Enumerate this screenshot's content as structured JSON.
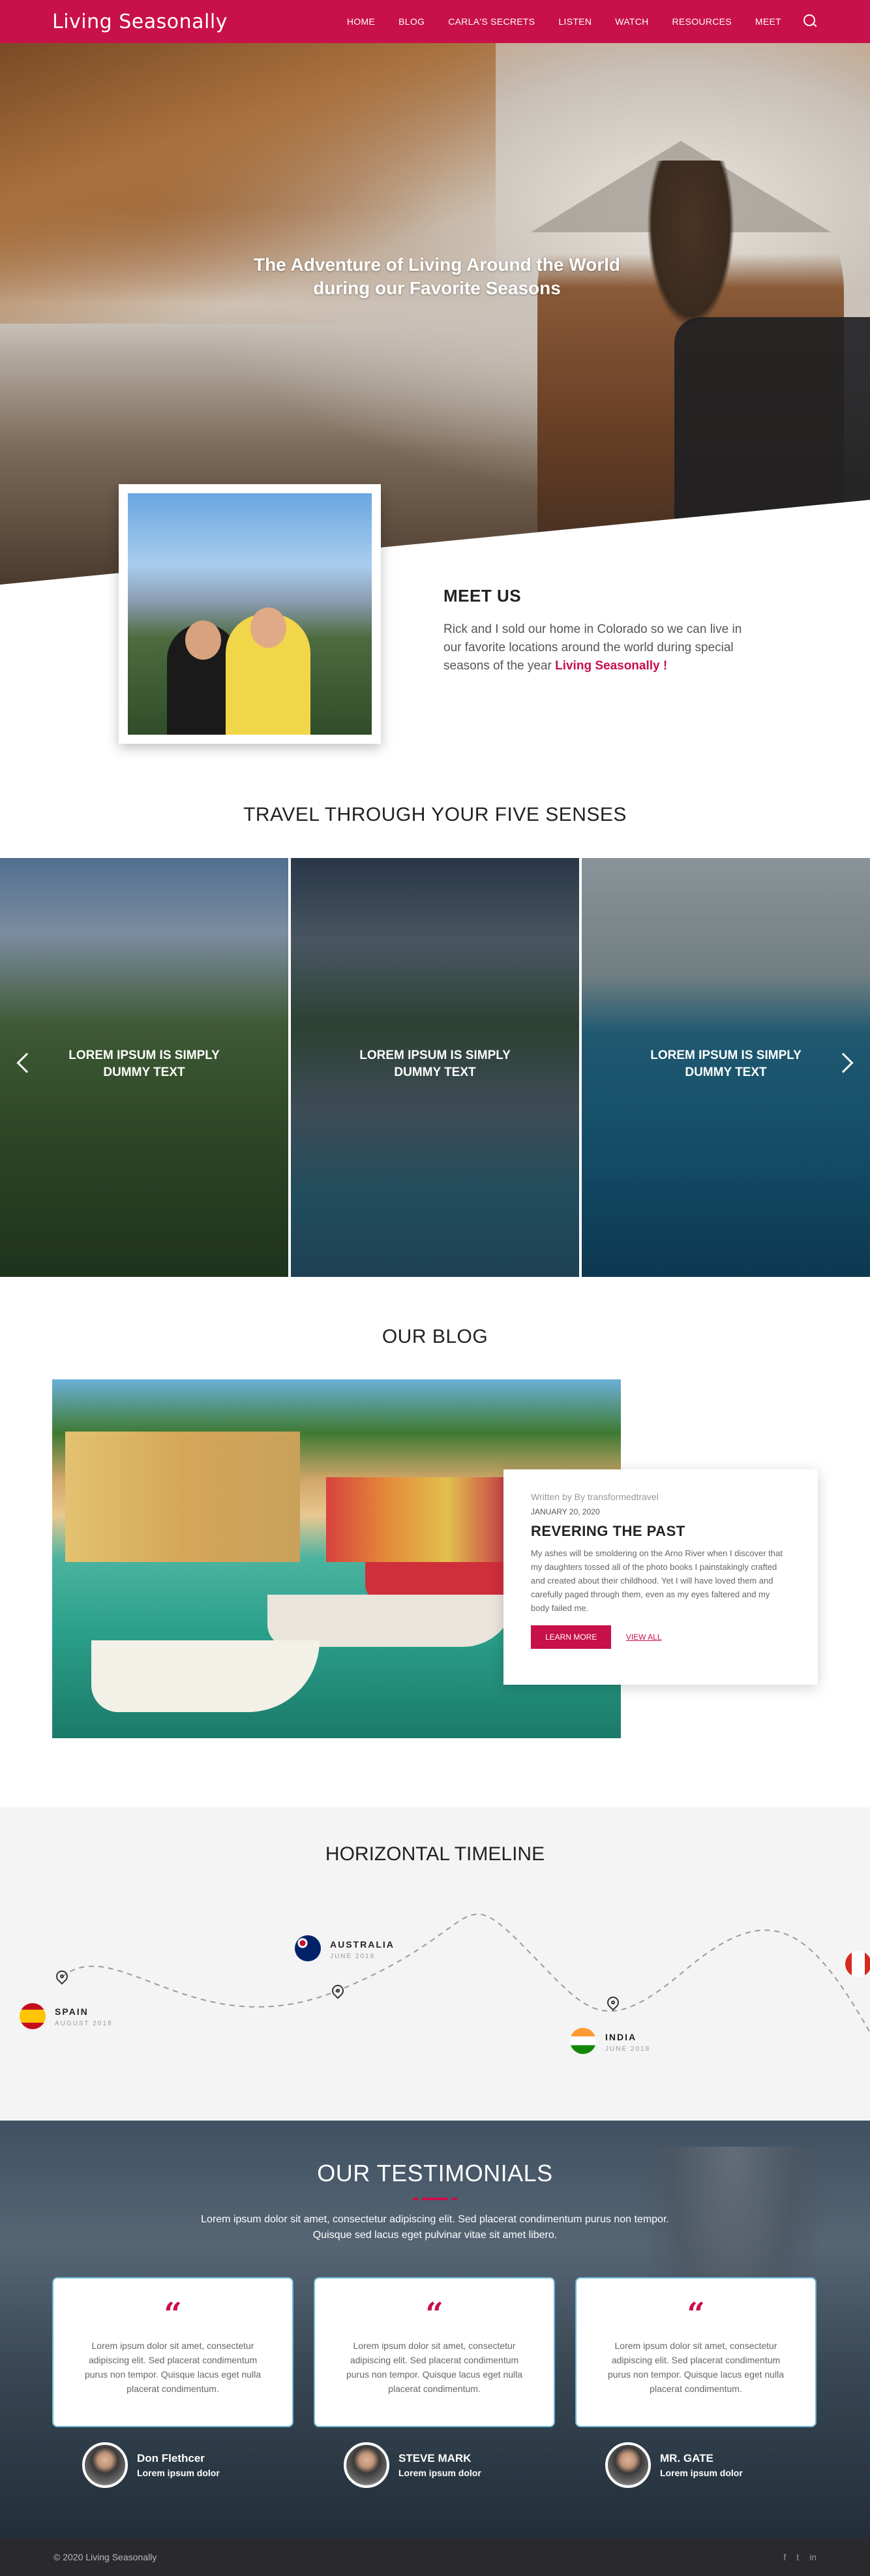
{
  "nav": {
    "logo": "Living Seasonally",
    "items": [
      "HOME",
      "BLOG",
      "CARLA'S SECRETS",
      "LISTEN",
      "WATCH",
      "RESOURCES",
      "MEET"
    ]
  },
  "hero": {
    "title_line1": "The Adventure of Living Around the World",
    "title_line2": "during our Favorite Seasons"
  },
  "meet": {
    "heading": "MEET US",
    "body": "Rick and I sold our home in Colorado so we can live in our favorite locations around the world during special seasons of the year",
    "accent": "Living Seasonally !"
  },
  "senses": {
    "heading": "TRAVEL THROUGH YOUR FIVE SENSES",
    "slides": [
      {
        "caption": "LOREM IPSUM IS SIMPLY DUMMY TEXT"
      },
      {
        "caption": "LOREM IPSUM IS SIMPLY DUMMY TEXT"
      },
      {
        "caption": "LOREM IPSUM IS SIMPLY DUMMY TEXT"
      }
    ]
  },
  "blog": {
    "heading": "OUR BLOG",
    "by": "Written by By transformedtravel",
    "date": "JANUARY 20, 2020",
    "title": "REVERING THE PAST",
    "excerpt": "My ashes will be smoldering on the Arno River when I discover that my daughters tossed all of the photo books I painstakingly crafted and created about their childhood. Yet I will have loved them and carefully paged through them, even as my eyes faltered and my body failed me.",
    "learn_more": "LEARN MORE",
    "view_all": "VIEW ALL"
  },
  "timeline": {
    "heading": "HORIZONTAL TIMELINE",
    "items": [
      {
        "name": "SPAIN",
        "date": "AUGUST 2018"
      },
      {
        "name": "AUSTRALIA",
        "date": "JUNE 2018"
      },
      {
        "name": "INDIA",
        "date": "JUNE 2018"
      }
    ]
  },
  "testimonials": {
    "heading": "OUR TESTIMONIALS",
    "intro_line1": "Lorem ipsum dolor sit amet, consectetur adipiscing elit. Sed placerat condimentum purus non tempor.",
    "intro_line2": "Quisque sed lacus eget  pulvinar vitae sit amet libero.",
    "cards": [
      {
        "quote": "Lorem ipsum dolor sit amet, consectetur adipiscing elit. Sed placerat condimentum purus non tempor. Quisque lacus eget nulla placerat condimentum.",
        "name": "Don Flethcer",
        "role": "Lorem ipsum dolor"
      },
      {
        "quote": "Lorem ipsum dolor sit amet, consectetur adipiscing elit. Sed placerat condimentum purus non tempor. Quisque lacus eget nulla placerat condimentum.",
        "name": "STEVE MARK",
        "role": "Lorem ipsum dolor"
      },
      {
        "quote": "Lorem ipsum dolor sit amet, consectetur adipiscing elit. Sed placerat condimentum purus non tempor. Quisque lacus eget nulla placerat condimentum.",
        "name": "MR. GATE",
        "role": "Lorem ipsum dolor"
      }
    ]
  },
  "footer": {
    "copyright": "© 2020 Living Seasonally",
    "social": [
      "f",
      "t",
      "in"
    ]
  },
  "colors": {
    "brand": "#c8104a",
    "footer": "#2a2a2e",
    "timeline_bg": "#f4f4f4"
  }
}
